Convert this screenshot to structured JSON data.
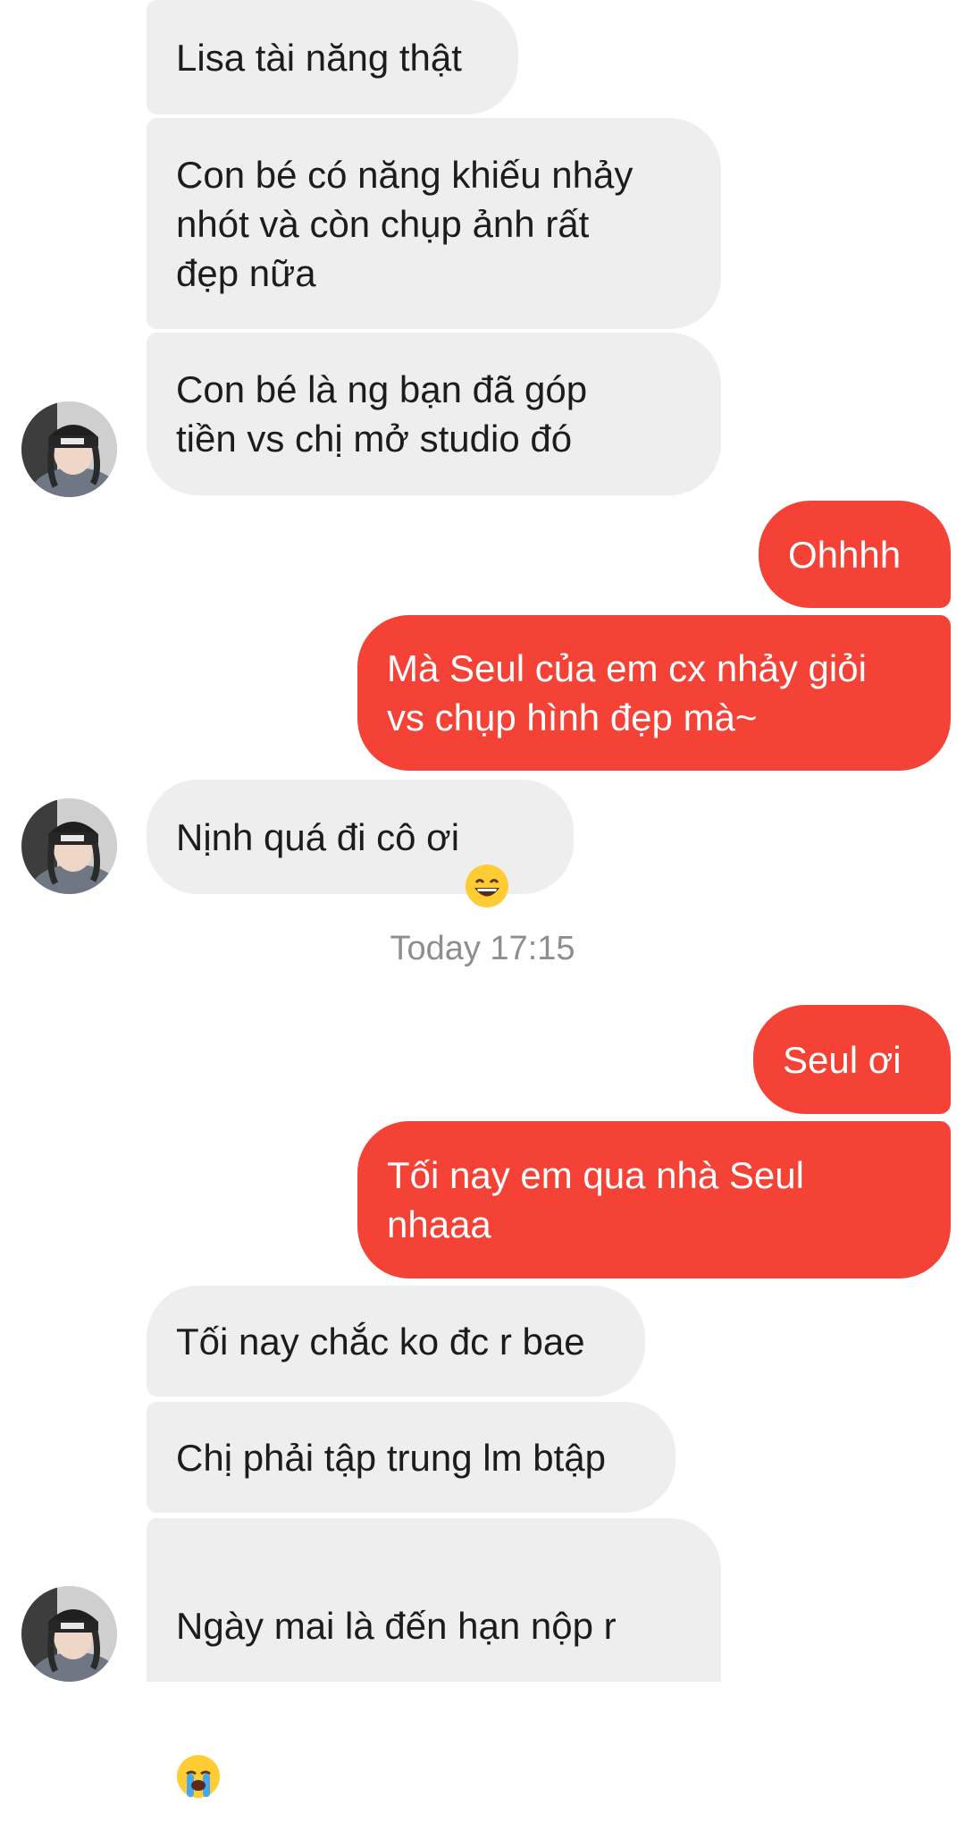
{
  "messages": [
    {
      "text": "Lisa tài năng thật"
    },
    {
      "text": "Con bé có năng khiếu nhảy\nnhót và còn chụp ảnh rất\nđẹp nữa"
    },
    {
      "text": "Con bé là ng bạn đã góp\ntiền vs chị mở studio đó"
    },
    {
      "text": "Ohhhh"
    },
    {
      "text": "Mà Seul của em cx nhảy giỏi\nvs chụp hình đẹp mà~"
    },
    {
      "text": "Nịnh quá đi cô ơi",
      "emoji": "grinning-face-emoji"
    },
    {
      "text": "Seul ơi"
    },
    {
      "text": "Tối nay em qua nhà Seul\nnhaaa"
    },
    {
      "text": "Tối nay chắc ko đc r bae"
    },
    {
      "text": "Chị phải tập trung lm btập"
    },
    {
      "text": "Ngày mai là đến hạn nộp r",
      "emoji": "loudly-crying-face-emoji"
    }
  ],
  "timestamp": "Today 17:15",
  "colors": {
    "incoming_bubble": "#eeeeee",
    "outgoing_bubble": "#f44236",
    "timestamp_text": "#8e8e8e"
  },
  "icons": {
    "avatar": "contact-avatar-photo"
  }
}
